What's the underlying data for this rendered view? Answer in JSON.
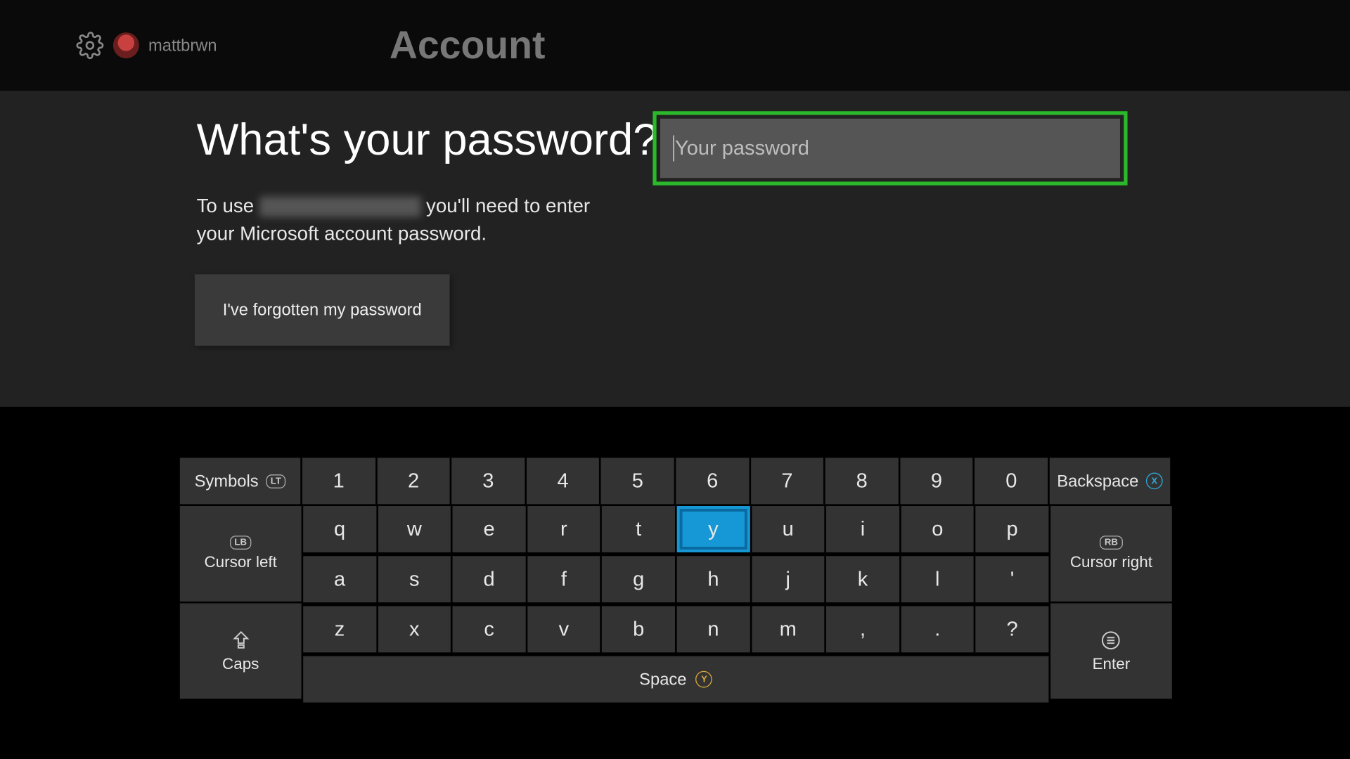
{
  "header": {
    "username": "mattbrwn",
    "title": "Account"
  },
  "prompt": {
    "heading": "What's your password?",
    "help_pre": "To use ",
    "help_post": " you'll need to enter your Microsoft account password.",
    "forgot_label": "I've forgotten my password",
    "password_placeholder": "Your password"
  },
  "keyboard": {
    "symbols": "Symbols",
    "symbols_badge": "LT",
    "backspace": "Backspace",
    "backspace_badge": "X",
    "cursor_left": "Cursor left",
    "cursor_left_badge": "LB",
    "cursor_right": "Cursor right",
    "cursor_right_badge": "RB",
    "caps": "Caps",
    "enter": "Enter",
    "space": "Space",
    "space_badge": "Y",
    "row_num": [
      "1",
      "2",
      "3",
      "4",
      "5",
      "6",
      "7",
      "8",
      "9",
      "0"
    ],
    "row_q": [
      "q",
      "w",
      "e",
      "r",
      "t",
      "y",
      "u",
      "i",
      "o",
      "p"
    ],
    "row_a": [
      "a",
      "s",
      "d",
      "f",
      "g",
      "h",
      "j",
      "k",
      "l",
      "'"
    ],
    "row_z": [
      "z",
      "x",
      "c",
      "v",
      "b",
      "n",
      "m",
      ",",
      ".",
      "?"
    ],
    "selected": "y"
  },
  "colors": {
    "highlight": "#2bb82b",
    "selected_key": "#1698d6"
  }
}
